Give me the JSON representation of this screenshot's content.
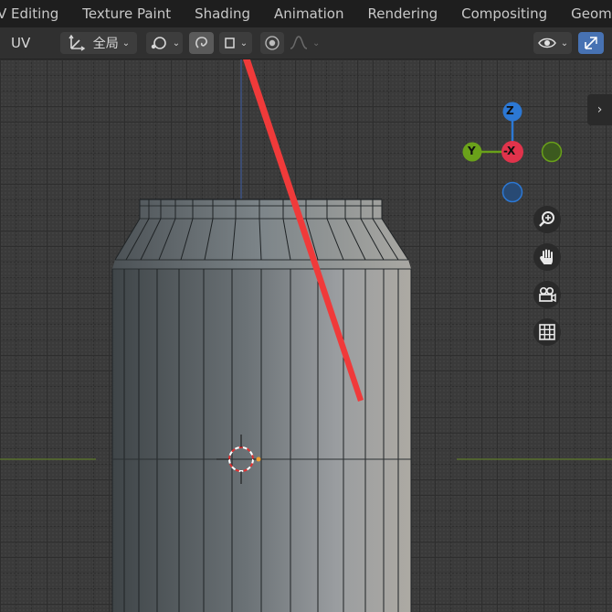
{
  "workspace_tabs": [
    {
      "label": "V Editing"
    },
    {
      "label": "Texture Paint"
    },
    {
      "label": "Shading"
    },
    {
      "label": "Animation"
    },
    {
      "label": "Rendering"
    },
    {
      "label": "Compositing"
    },
    {
      "label": "Geometry"
    }
  ],
  "header": {
    "uv_label": "UV",
    "pivot_label": "全局"
  },
  "gizmo": {
    "z_label": "Z",
    "y_label": "Y",
    "x_label": "-X",
    "colors": {
      "x": "#e0334b",
      "y": "#6aa11a",
      "z": "#2c78d4"
    }
  },
  "annotation": {
    "arrow_color": "#f03a3a"
  },
  "icons": [
    "transform-orientation-icon",
    "snap-icon",
    "proportional-edit-icon",
    "falloff-icon",
    "visibility-icon",
    "gizmo-toggle-icon",
    "zoom-icon",
    "hand-icon",
    "camera-icon",
    "grid-icon"
  ]
}
